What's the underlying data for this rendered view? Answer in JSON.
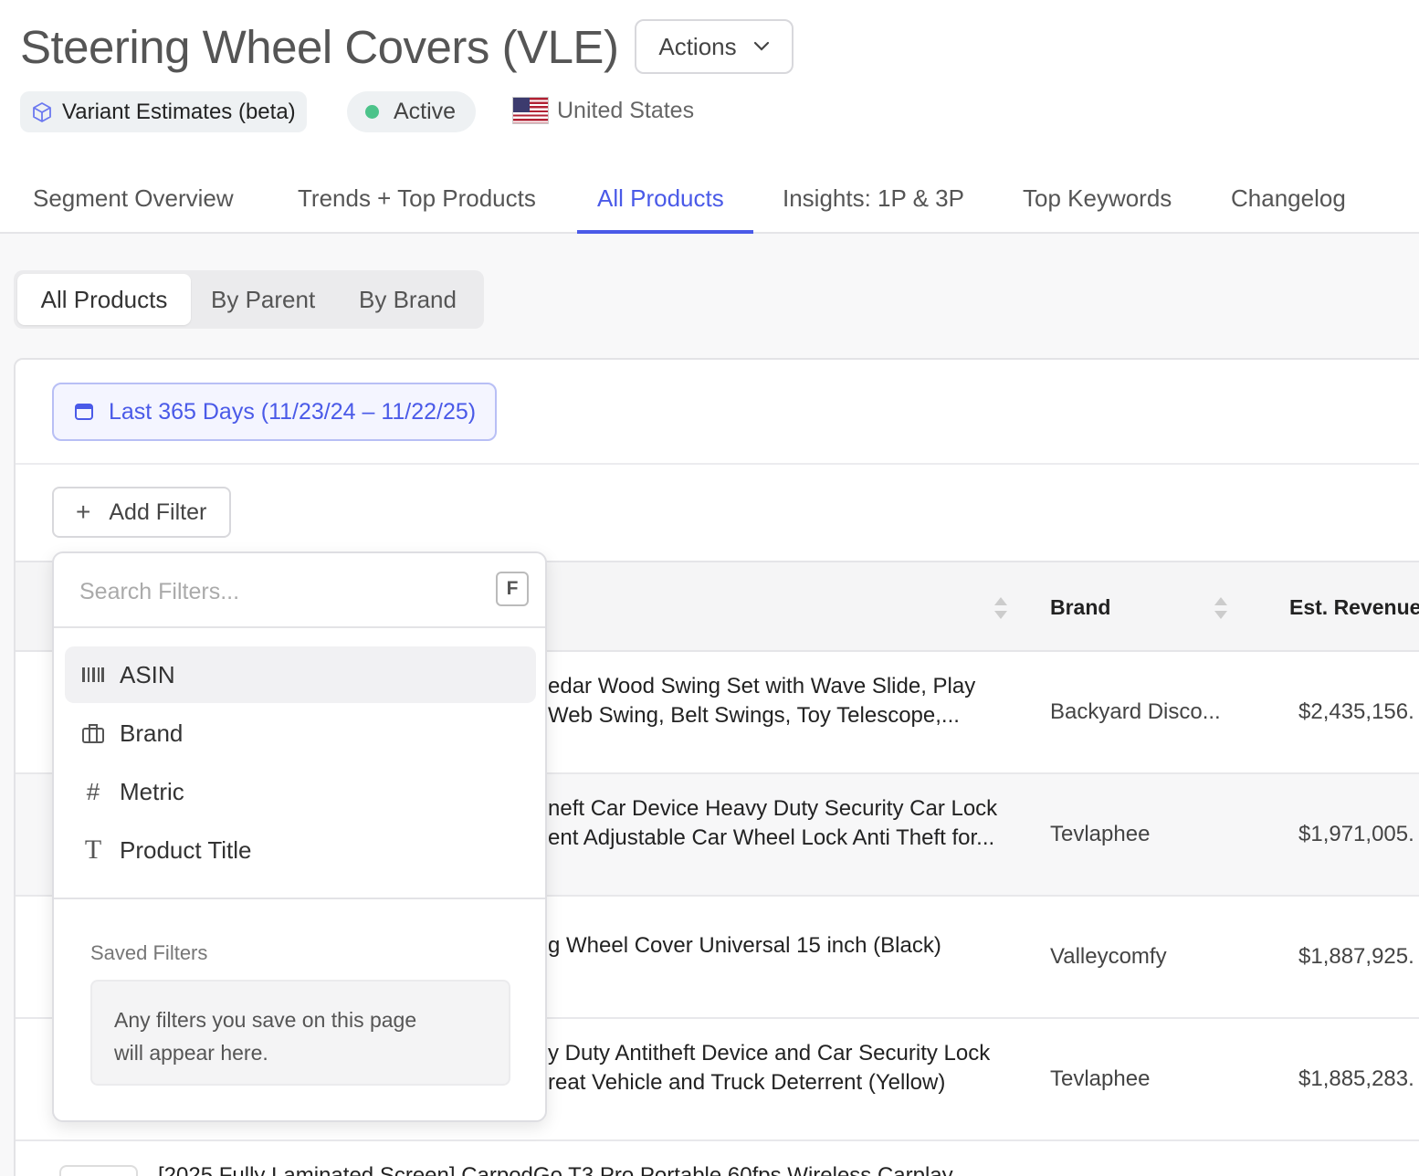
{
  "header": {
    "title": "Steering Wheel Covers (VLE)",
    "actions_label": "Actions",
    "variant_badge": "Variant Estimates (beta)",
    "status": "Active",
    "country": "United States"
  },
  "tabs": [
    {
      "label": "Segment Overview"
    },
    {
      "label": "Trends + Top Products"
    },
    {
      "label": "All Products"
    },
    {
      "label": "Insights: 1P & 3P"
    },
    {
      "label": "Top Keywords"
    },
    {
      "label": "Changelog"
    }
  ],
  "active_tab": "All Products",
  "segmented": [
    {
      "label": "All Products"
    },
    {
      "label": "By Parent"
    },
    {
      "label": "By Brand"
    }
  ],
  "date_range": "Last 365 Days (11/23/24 – 11/22/25)",
  "add_filter_label": "Add Filter",
  "table": {
    "columns": [
      "Brand",
      "Est. Revenue"
    ],
    "rows": [
      {
        "title_line1": "edar Wood Swing Set with Wave Slide, Play",
        "title_line2": "Web Swing, Belt Swings, Toy Telescope,...",
        "brand": "Backyard Disco...",
        "revenue": "$2,435,156."
      },
      {
        "title_line1": "neft Car Device Heavy Duty Security Car Lock",
        "title_line2": "ent Adjustable Car Wheel Lock Anti Theft for...",
        "brand": "Tevlaphee",
        "revenue": "$1,971,005."
      },
      {
        "title_line1": "g Wheel Cover Universal 15 inch (Black)",
        "title_line2": "",
        "brand": "Valleycomfy",
        "revenue": "$1,887,925."
      },
      {
        "title_line1": "y Duty Antitheft Device and Car Security Lock",
        "title_line2": "reat Vehicle and Truck Deterrent (Yellow)",
        "brand": "Tevlaphee",
        "revenue": "$1,885,283."
      }
    ],
    "partial_row_title": "[2025 Fully Laminated Screen] CarpodGo T3 Pro Portable 60fps Wireless Carplay"
  },
  "filter_dropdown": {
    "search_placeholder": "Search Filters...",
    "shortcut": "F",
    "items": [
      {
        "label": "ASIN",
        "icon": "barcode-icon"
      },
      {
        "label": "Brand",
        "icon": "briefcase-icon"
      },
      {
        "label": "Metric",
        "icon": "hash-icon"
      },
      {
        "label": "Product Title",
        "icon": "text-icon"
      }
    ],
    "saved_title": "Saved Filters",
    "saved_empty_line1": "Any filters you save on this page",
    "saved_empty_line2": "will appear here."
  },
  "colors": {
    "accent": "#4a5ae8",
    "status_green": "#4cc38a"
  }
}
